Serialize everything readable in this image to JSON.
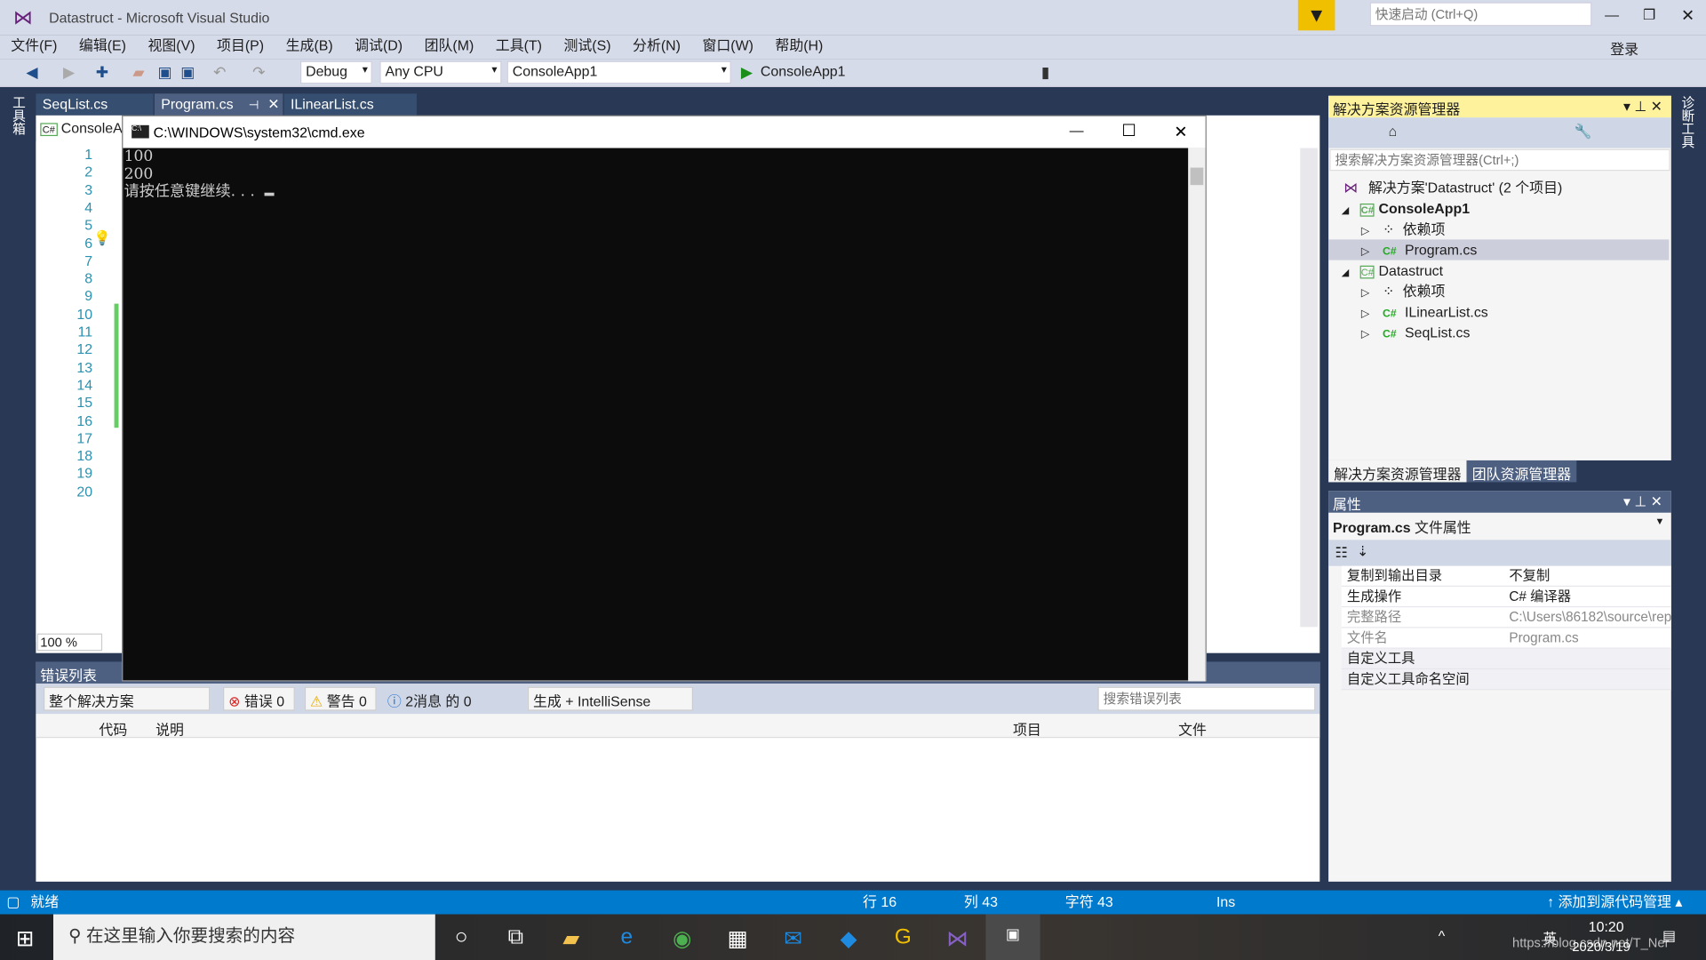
{
  "window": {
    "title": "Datastruct - Microsoft Visual Studio",
    "quick_launch_placeholder": "快速启动 (Ctrl+Q)",
    "login": "登录"
  },
  "menu": [
    "文件(F)",
    "编辑(E)",
    "视图(V)",
    "项目(P)",
    "生成(B)",
    "调试(D)",
    "团队(M)",
    "工具(T)",
    "测试(S)",
    "分析(N)",
    "窗口(W)",
    "帮助(H)"
  ],
  "toolbar": {
    "config": "Debug",
    "platform": "Any CPU",
    "startup_project": "ConsoleApp1",
    "run_label": "ConsoleApp1"
  },
  "side_left": "工具箱",
  "side_right": "诊断工具",
  "tabs": [
    {
      "label": "SeqList.cs"
    },
    {
      "label": "Program.cs"
    },
    {
      "label": "ILinearList.cs"
    }
  ],
  "editor": {
    "nav_project": "ConsoleApp1",
    "line_numbers": [
      "1",
      "2",
      "3",
      "4",
      "5",
      "6",
      "7",
      "8",
      "9",
      "10",
      "11",
      "12",
      "13",
      "14",
      "15",
      "16",
      "17",
      "18",
      "19",
      "20"
    ],
    "zoom": "100 %"
  },
  "cmd": {
    "title": "C:\\WINDOWS\\system32\\cmd.exe",
    "lines": [
      "100",
      "200",
      "请按任意键继续. . . "
    ]
  },
  "error_list": {
    "title": "错误列表",
    "scope": "整个解决方案",
    "errors": "错误 0",
    "warnings": "警告 0",
    "messages": "2消息 的 0",
    "source": "生成 + IntelliSense",
    "search_placeholder": "搜索错误列表",
    "columns": [
      "代码",
      "说明",
      "项目",
      "文件"
    ]
  },
  "solution_explorer": {
    "title": "解决方案资源管理器",
    "search_placeholder": "搜索解决方案资源管理器(Ctrl+;)",
    "tree": [
      {
        "label": "解决方案'Datastruct' (2 个项目)"
      },
      {
        "label": "ConsoleApp1"
      },
      {
        "label": "依赖项"
      },
      {
        "label": "Program.cs"
      },
      {
        "label": "Datastruct"
      },
      {
        "label": "依赖项"
      },
      {
        "label": "ILinearList.cs"
      },
      {
        "label": "SeqList.cs"
      }
    ],
    "bottom_tabs": [
      "解决方案资源管理器",
      "团队资源管理器"
    ]
  },
  "properties": {
    "title": "属性",
    "object": "Program.cs",
    "object_type": "文件属性",
    "rows": [
      {
        "k": "复制到输出目录",
        "v": "不复制"
      },
      {
        "k": "生成操作",
        "v": "C# 编译器"
      },
      {
        "k": "完整路径",
        "v": "C:\\Users\\86182\\source\\rep"
      },
      {
        "k": "文件名",
        "v": "Program.cs"
      },
      {
        "k": "自定义工具",
        "v": ""
      },
      {
        "k": "自定义工具命名空间",
        "v": ""
      }
    ]
  },
  "status": {
    "ready": "就绪",
    "line": "行 16",
    "col": "列 43",
    "char": "字符 43",
    "mode": "Ins",
    "source_control": "添加到源代码管理"
  },
  "taskbar": {
    "search_placeholder": "在这里输入你要搜索的内容",
    "time": "10:20",
    "date": "2020/3/19",
    "ime": "英",
    "watermark": "https://blog.csdn.net/T_Ner"
  },
  "colors": {
    "accent": "#007acc",
    "console_bg": "#0c0c0c",
    "tab_bg": "#364e6f"
  }
}
